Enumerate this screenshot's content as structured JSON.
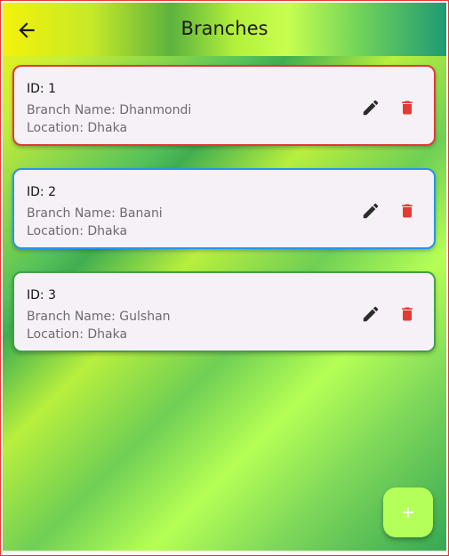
{
  "appbar": {
    "title": "Branches",
    "back_icon": "arrow-back-icon"
  },
  "colors": {
    "card_borders": [
      "#e53935",
      "#2196f3",
      "#43a047"
    ],
    "delete_icon": "#e53935",
    "fab_background": "#b5ff5a"
  },
  "branches": [
    {
      "id_text": "ID: 1",
      "name_text": "Branch Name: Dhanmondi",
      "location_text": "Location: Dhaka"
    },
    {
      "id_text": "ID: 2",
      "name_text": "Branch Name: Banani",
      "location_text": "Location: Dhaka"
    },
    {
      "id_text": "ID: 3",
      "name_text": "Branch Name: Gulshan",
      "location_text": "Location: Dhaka"
    }
  ],
  "icons": {
    "edit": "pencil-icon",
    "delete": "trash-icon",
    "fab": "plus-icon"
  }
}
